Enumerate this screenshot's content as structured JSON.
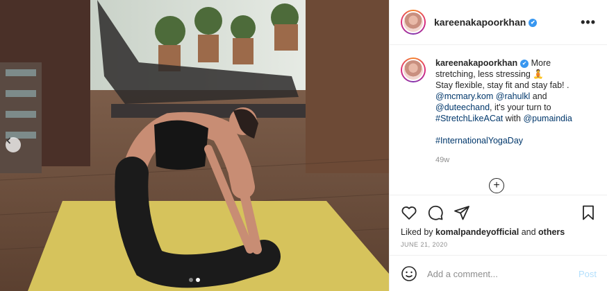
{
  "post": {
    "username": "kareenakapoorkhan",
    "verified_icon": "verified-badge-icon",
    "more_icon": "more-options-icon",
    "caption": {
      "username": "kareenakapoorkhan",
      "line1": "More stretching, less stressing ",
      "emoji": "🧘",
      "line2": "Stay flexible, stay fit and stay fab! .",
      "mention1": "@mcmary.kom",
      "mention2": "@rahulkl",
      "and1": " and",
      "mention3": "@duteechand",
      "turn": ", it's your turn to",
      "hashtag1": "#StretchLikeACat",
      "with": " with ",
      "mention4": "@pumaindia",
      "hashtag2": "#InternationalYogaDay"
    },
    "time_ago": "49w",
    "load_more_icon": "plus-circle-icon",
    "likes": {
      "prefix": "Liked by ",
      "user": "komalpandeyofficial",
      "middle": " and ",
      "others": "others"
    },
    "date": "JUNE 21, 2020",
    "add_comment": {
      "placeholder": "Add a comment...",
      "post_label": "Post"
    }
  },
  "carousel": {
    "slides": 2,
    "active": 2
  },
  "colors": {
    "link": "#00376b",
    "verified": "#3897f0",
    "muted": "#8e8e8e",
    "post_button": "#b2dffc"
  }
}
